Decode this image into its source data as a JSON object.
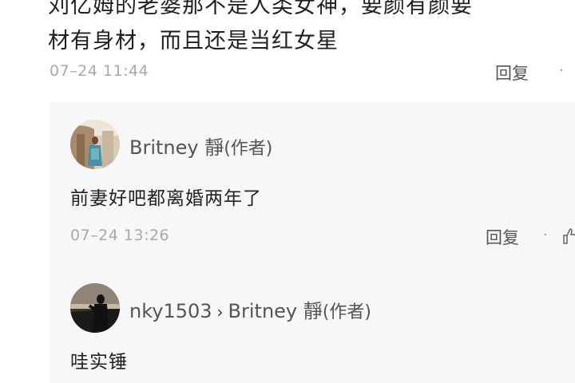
{
  "post": {
    "lines": [
      "刘亿姆的老婆那不是人类女神，要颜有颜要",
      "材有身材，而且还是当红女星"
    ],
    "timestamp": "07–24  11:44",
    "reply_label": "回复"
  },
  "replies": [
    {
      "username": "Britney  靜",
      "author_tag": "(作者)",
      "text": "前妻好吧都离婚两年了",
      "timestamp": "07–24  13:26",
      "reply_label": "回复"
    },
    {
      "username": "nky1503",
      "target": "Britney  靜",
      "author_tag": "(作者)",
      "text": "哇实锤"
    }
  ],
  "icons": {
    "like": "thumbs-up-icon",
    "separator": "dot-icon",
    "arrow": "chevron-right-icon"
  },
  "colors": {
    "panel_bg": "#f7f7f9",
    "meta_gray": "#a9a9a9"
  }
}
